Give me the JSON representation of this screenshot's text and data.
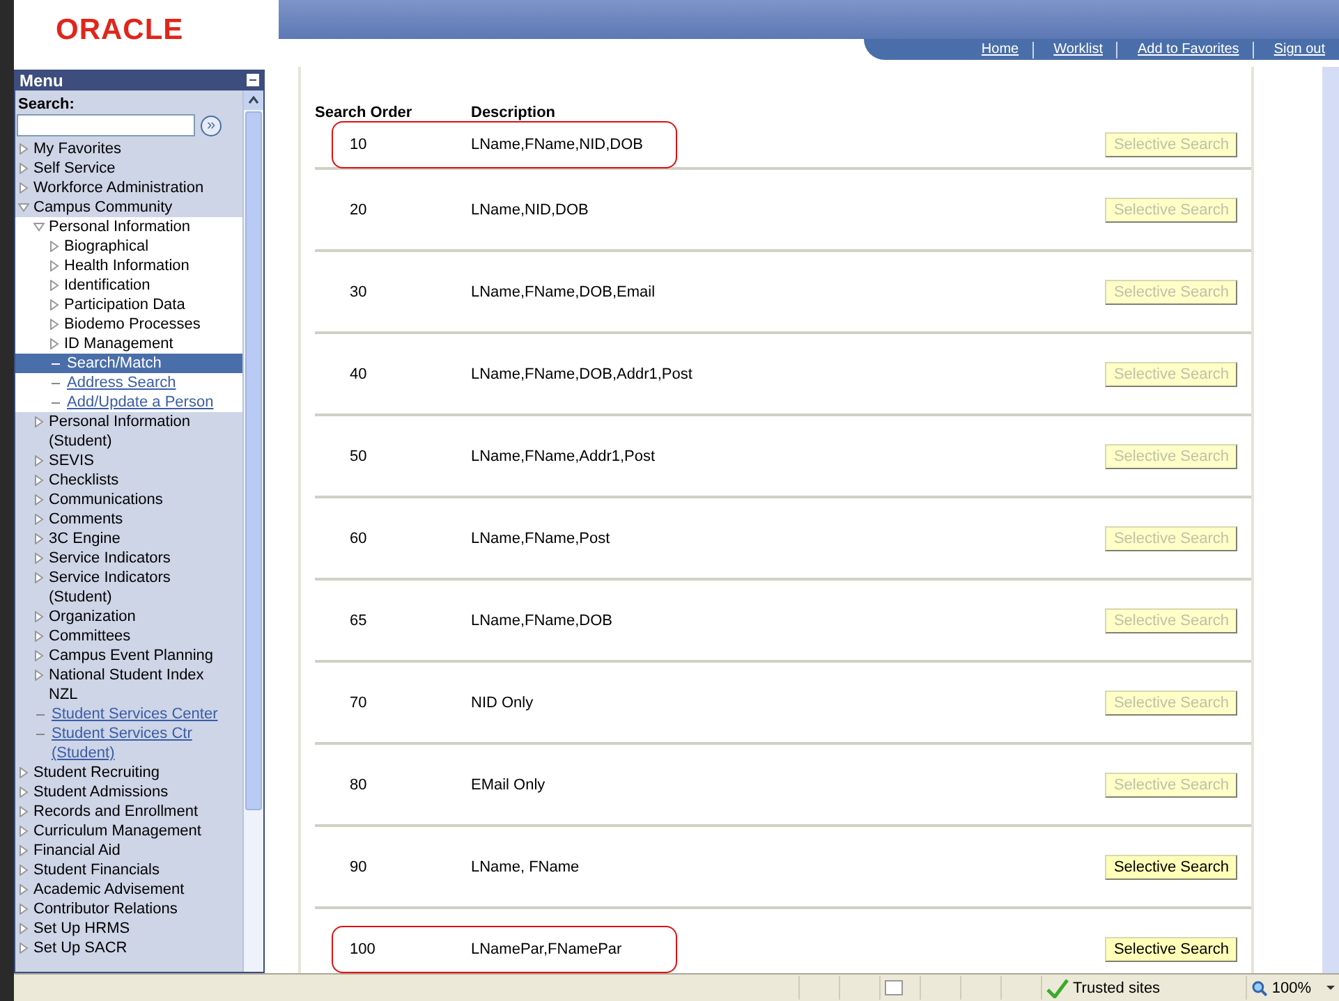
{
  "header": {
    "logo": "ORACLE",
    "nav_links": [
      "Home",
      "Worklist",
      "Add to Favorites",
      "Sign out"
    ]
  },
  "menu": {
    "title": "Menu",
    "search_label": "Search:",
    "go_button": "»",
    "items": [
      {
        "label": "My Favorites",
        "kind": "folder",
        "expanded": false
      },
      {
        "label": "Self Service",
        "kind": "folder",
        "expanded": false
      },
      {
        "label": "Workforce Administration",
        "kind": "folder",
        "expanded": false
      },
      {
        "label": "Campus Community",
        "kind": "folder",
        "expanded": true,
        "children": [
          {
            "label": "Personal Information",
            "kind": "folder",
            "expanded": true,
            "children": [
              {
                "label": "Biographical",
                "kind": "folder",
                "expanded": false
              },
              {
                "label": "Health Information",
                "kind": "folder",
                "expanded": false
              },
              {
                "label": "Identification",
                "kind": "folder",
                "expanded": false
              },
              {
                "label": "Participation Data",
                "kind": "folder",
                "expanded": false
              },
              {
                "label": "Biodemo Processes",
                "kind": "folder",
                "expanded": false
              },
              {
                "label": "ID Management",
                "kind": "folder",
                "expanded": false
              },
              {
                "label": "Search/Match",
                "kind": "link",
                "selected": true
              },
              {
                "label": "Address Search",
                "kind": "link",
                "selected": false
              },
              {
                "label": "Add/Update a Person",
                "kind": "link",
                "selected": false
              }
            ]
          },
          {
            "label": "Personal Information (Student)",
            "kind": "folder",
            "expanded": false
          },
          {
            "label": "SEVIS",
            "kind": "folder",
            "expanded": false
          },
          {
            "label": "Checklists",
            "kind": "folder",
            "expanded": false
          },
          {
            "label": "Communications",
            "kind": "folder",
            "expanded": false
          },
          {
            "label": "Comments",
            "kind": "folder",
            "expanded": false
          },
          {
            "label": "3C Engine",
            "kind": "folder",
            "expanded": false
          },
          {
            "label": "Service Indicators",
            "kind": "folder",
            "expanded": false
          },
          {
            "label": "Service Indicators (Student)",
            "kind": "folder",
            "expanded": false
          },
          {
            "label": "Organization",
            "kind": "folder",
            "expanded": false
          },
          {
            "label": "Committees",
            "kind": "folder",
            "expanded": false
          },
          {
            "label": "Campus Event Planning",
            "kind": "folder",
            "expanded": false
          },
          {
            "label": "National Student Index NZL",
            "kind": "folder",
            "expanded": false
          },
          {
            "label": "Student Services Center",
            "kind": "link",
            "selected": false
          },
          {
            "label": "Student Services Ctr (Student)",
            "kind": "link",
            "selected": false
          }
        ]
      },
      {
        "label": "Student Recruiting",
        "kind": "folder",
        "expanded": false
      },
      {
        "label": "Student Admissions",
        "kind": "folder",
        "expanded": false
      },
      {
        "label": "Records and Enrollment",
        "kind": "folder",
        "expanded": false
      },
      {
        "label": "Curriculum Management",
        "kind": "folder",
        "expanded": false
      },
      {
        "label": "Financial Aid",
        "kind": "folder",
        "expanded": false
      },
      {
        "label": "Student Financials",
        "kind": "folder",
        "expanded": false
      },
      {
        "label": "Academic Advisement",
        "kind": "folder",
        "expanded": false
      },
      {
        "label": "Contributor Relations",
        "kind": "folder",
        "expanded": false
      },
      {
        "label": "Set Up HRMS",
        "kind": "folder",
        "expanded": false
      },
      {
        "label": "Set Up SACR",
        "kind": "folder",
        "expanded": false
      }
    ]
  },
  "table": {
    "columns": [
      "Search Order",
      "Description"
    ],
    "rows": [
      {
        "order": "10",
        "description": "LName,FName,NID,DOB",
        "button": "Selective Search",
        "disabled": true,
        "highlighted": true
      },
      {
        "order": "20",
        "description": "LName,NID,DOB",
        "button": "Selective Search",
        "disabled": true,
        "highlighted": false
      },
      {
        "order": "30",
        "description": "LName,FName,DOB,Email",
        "button": "Selective Search",
        "disabled": true,
        "highlighted": false
      },
      {
        "order": "40",
        "description": "LName,FName,DOB,Addr1,Post",
        "button": "Selective Search",
        "disabled": true,
        "highlighted": false
      },
      {
        "order": "50",
        "description": "LName,FName,Addr1,Post",
        "button": "Selective Search",
        "disabled": true,
        "highlighted": false
      },
      {
        "order": "60",
        "description": "LName,FName,Post",
        "button": "Selective Search",
        "disabled": true,
        "highlighted": false
      },
      {
        "order": "65",
        "description": "LName,FName,DOB",
        "button": "Selective Search",
        "disabled": true,
        "highlighted": false
      },
      {
        "order": "70",
        "description": "NID Only",
        "button": "Selective Search",
        "disabled": true,
        "highlighted": false
      },
      {
        "order": "80",
        "description": "EMail Only",
        "button": "Selective Search",
        "disabled": true,
        "highlighted": false
      },
      {
        "order": "90",
        "description": "LName, FName",
        "button": "Selective Search",
        "disabled": false,
        "highlighted": false
      },
      {
        "order": "100",
        "description": "LNamePar,FNamePar",
        "button": "Selective Search",
        "disabled": false,
        "highlighted": true
      }
    ]
  },
  "status_bar": {
    "zone": "Trusted sites",
    "zoom": "100%"
  }
}
